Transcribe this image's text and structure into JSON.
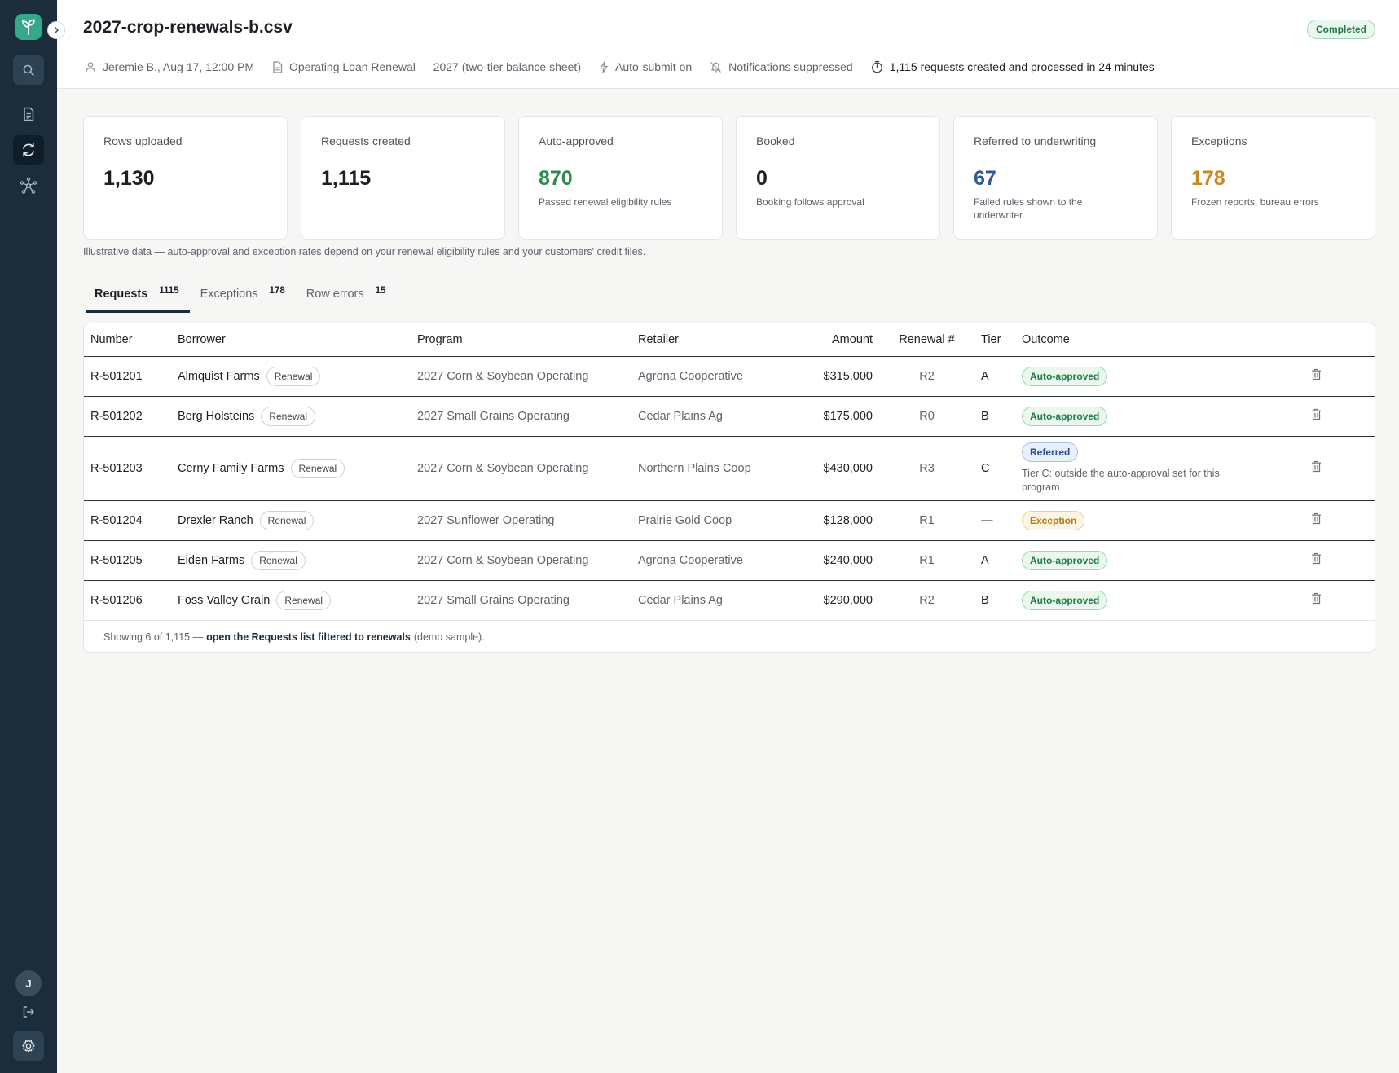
{
  "header": {
    "title": "2027-crop-renewals-b.csv",
    "status": "Completed",
    "meta": {
      "user": "Jeremie B., Aug 17, 12:00 PM",
      "template": "Operating Loan Renewal — 2027 (two-tier balance sheet)",
      "auto_submit": "Auto-submit on",
      "notifications": "Notifications suppressed",
      "summary": "1,115 requests created and processed in 24 minutes"
    }
  },
  "sidebar": {
    "avatar_initial": "J"
  },
  "stats": [
    {
      "label": "Rows uploaded",
      "value": "1,130",
      "sub": ""
    },
    {
      "label": "Requests created",
      "value": "1,115",
      "sub": ""
    },
    {
      "label": "Auto-approved",
      "value": "870",
      "sub": "Passed renewal eligibility rules",
      "color": "#2f8a50"
    },
    {
      "label": "Booked",
      "value": "0",
      "sub": "Booking follows approval"
    },
    {
      "label": "Referred to underwriting",
      "value": "67",
      "sub": "Failed rules shown to the underwriter",
      "color": "#2e5a9c"
    },
    {
      "label": "Exceptions",
      "value": "178",
      "sub": "Frozen reports, bureau errors",
      "color": "#c88a1e"
    }
  ],
  "footnote": "Illustrative data — auto-approval and exception rates depend on your renewal eligibility rules and your customers' credit files.",
  "tabs": [
    {
      "label": "Requests",
      "count": "1115"
    },
    {
      "label": "Exceptions",
      "count": "178"
    },
    {
      "label": "Row errors",
      "count": "15"
    }
  ],
  "table": {
    "columns": {
      "number": "Number",
      "borrower": "Borrower",
      "program": "Program",
      "retailer": "Retailer",
      "amount": "Amount",
      "renewal": "Renewal #",
      "tier": "Tier",
      "outcome": "Outcome"
    },
    "renewal_tag": "Renewal",
    "rows": [
      {
        "number": "R-501201",
        "borrower": "Almquist Farms",
        "program": "2027 Corn & Soybean Operating",
        "retailer": "Agrona Cooperative",
        "amount": "$315,000",
        "renewal": "R2",
        "tier": "A",
        "outcome": "Auto-approved",
        "note": ""
      },
      {
        "number": "R-501202",
        "borrower": "Berg Holsteins",
        "program": "2027 Small Grains Operating",
        "retailer": "Cedar Plains Ag",
        "amount": "$175,000",
        "renewal": "R0",
        "tier": "B",
        "outcome": "Auto-approved",
        "note": ""
      },
      {
        "number": "R-501203",
        "borrower": "Cerny Family Farms",
        "program": "2027 Corn & Soybean Operating",
        "retailer": "Northern Plains Coop",
        "amount": "$430,000",
        "renewal": "R3",
        "tier": "C",
        "outcome": "Referred",
        "note": "Tier C: outside the auto-approval set for this program"
      },
      {
        "number": "R-501204",
        "borrower": "Drexler Ranch",
        "program": "2027 Sunflower Operating",
        "retailer": "Prairie Gold Coop",
        "amount": "$128,000",
        "renewal": "R1",
        "tier": "—",
        "outcome": "Exception",
        "note": ""
      },
      {
        "number": "R-501205",
        "borrower": "Eiden Farms",
        "program": "2027 Corn & Soybean Operating",
        "retailer": "Agrona Cooperative",
        "amount": "$240,000",
        "renewal": "R1",
        "tier": "A",
        "outcome": "Auto-approved",
        "note": ""
      },
      {
        "number": "R-501206",
        "borrower": "Foss Valley Grain",
        "program": "2027 Small Grains Operating",
        "retailer": "Cedar Plains Ag",
        "amount": "$290,000",
        "renewal": "R2",
        "tier": "B",
        "outcome": "Auto-approved",
        "note": ""
      }
    ],
    "footer": {
      "prefix": "Showing 6 of 1,115 —",
      "link": "open the Requests list filtered to renewals",
      "suffix": "(demo sample)."
    }
  },
  "colors": {
    "sidebar": "#1b2c3a",
    "brand": "#35a98a",
    "auto_approved": "#2f8a50",
    "referred": "#2e5a9c",
    "exception": "#c88a1e"
  }
}
